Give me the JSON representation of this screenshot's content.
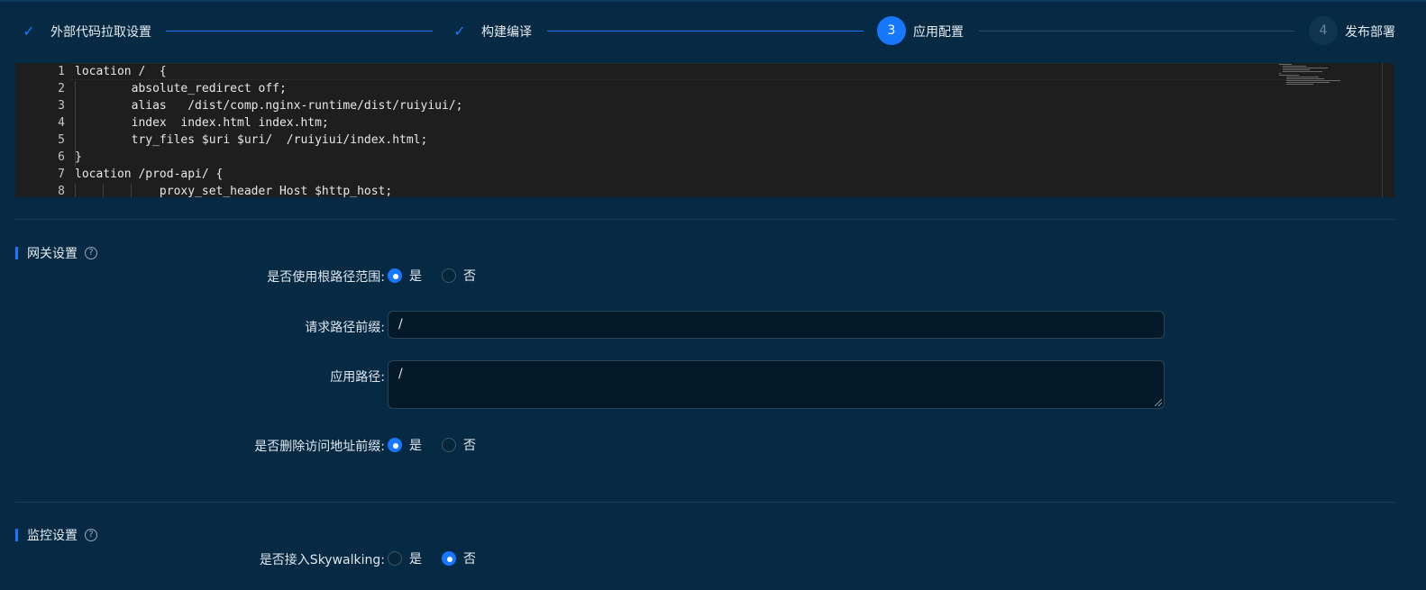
{
  "steps": [
    {
      "label": "外部代码拉取设置",
      "status": "done",
      "icon": "check-icon",
      "number": ""
    },
    {
      "label": "构建编译",
      "status": "done",
      "icon": "check-icon",
      "number": ""
    },
    {
      "label": "应用配置",
      "status": "active",
      "icon": "",
      "number": "3"
    },
    {
      "label": "发布部署",
      "status": "wait",
      "icon": "",
      "number": "4"
    }
  ],
  "editor": {
    "lines": [
      {
        "n": "1",
        "text": "location /  {"
      },
      {
        "n": "2",
        "text": "        absolute_redirect off;"
      },
      {
        "n": "3",
        "text": "        alias   /dist/comp.nginx-runtime/dist/ruiyiui/;"
      },
      {
        "n": "4",
        "text": "        index  index.html index.htm;"
      },
      {
        "n": "5",
        "text": "        try_files $uri $uri/  /ruiyiui/index.html;"
      },
      {
        "n": "6",
        "text": "}"
      },
      {
        "n": "7",
        "text": "location /prod-api/ {"
      },
      {
        "n": "8",
        "text": "            proxy_set_header Host $http_host;"
      }
    ]
  },
  "gateway": {
    "title": "网关设置",
    "use_root_label": "是否使用根路径范围:",
    "use_root_options": [
      "是",
      "否"
    ],
    "use_root_selected": "是",
    "prefix_label": "请求路径前缀:",
    "prefix_value": "/",
    "app_path_label": "应用路径:",
    "app_path_value": "/",
    "strip_prefix_label": "是否删除访问地址前缀:",
    "strip_prefix_options": [
      "是",
      "否"
    ],
    "strip_prefix_selected": "是"
  },
  "monitor": {
    "title": "监控设置",
    "skywalking_label": "是否接入Skywalking:",
    "skywalking_options": [
      "是",
      "否"
    ],
    "skywalking_selected": "否"
  },
  "colors": {
    "background": "#062a43",
    "accent": "#1677ff",
    "editor_bg": "#1e1e1e"
  }
}
